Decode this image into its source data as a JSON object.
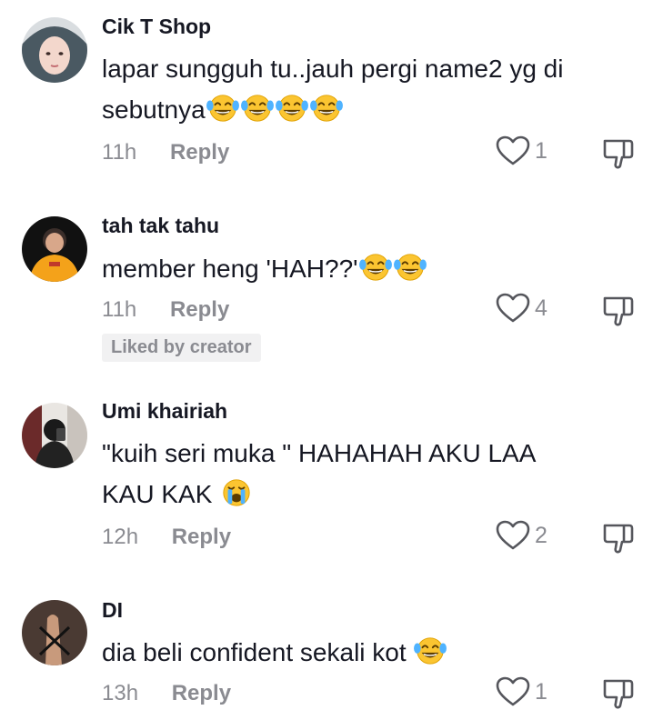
{
  "comments": [
    {
      "username": "Cik T Shop",
      "text": "lapar sungguh tu..jauh pergi name2 yg di sebutnya",
      "emoji": "laughing-crying-emoji x4",
      "time": "11h",
      "reply_label": "Reply",
      "likes": "1"
    },
    {
      "username": "tah tak tahu",
      "text": "member heng 'HAH??'",
      "emoji": "laughing-crying-emoji x2",
      "time": "11h",
      "reply_label": "Reply",
      "likes": "4",
      "badge": "Liked by creator"
    },
    {
      "username": "Umi khairiah",
      "text_line1": "\"kuih seri muka \" HAHAHAH AKU LAA",
      "text_line2": "KAU KAK",
      "emoji": "loudly-crying-emoji",
      "time": "12h",
      "reply_label": "Reply",
      "likes": "2"
    },
    {
      "username": "DI",
      "text": "dia beli confident sekali kot",
      "emoji": "laughing-crying-emoji",
      "time": "13h",
      "reply_label": "Reply",
      "likes": "1"
    }
  ],
  "icons": {
    "like": "heart-outline-icon",
    "dislike": "thumbs-down-outline-icon"
  },
  "colors": {
    "primary_text": "#161823",
    "secondary_text": "#8a8b91",
    "badge_bg": "#f1f1f2"
  }
}
